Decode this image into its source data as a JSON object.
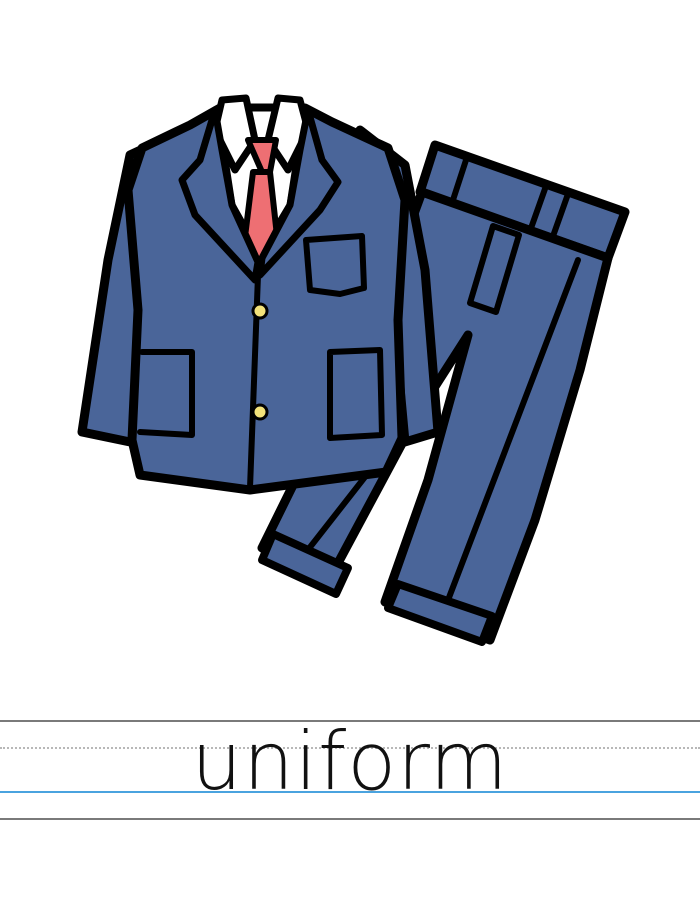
{
  "card": {
    "word": "uniform"
  },
  "illustration": {
    "subject": "suit-jacket-and-trousers",
    "colors": {
      "fabric": "#4a6599",
      "outline": "#000000",
      "tie": "#ee6f73",
      "shirt": "#ffffff",
      "button": "#f3e27a"
    }
  },
  "lines": {
    "colors": {
      "top": "#7a7a7a",
      "midline": "#b8b8b8",
      "baseline": "#4aa3df",
      "bottom": "#7a7a7a"
    }
  }
}
